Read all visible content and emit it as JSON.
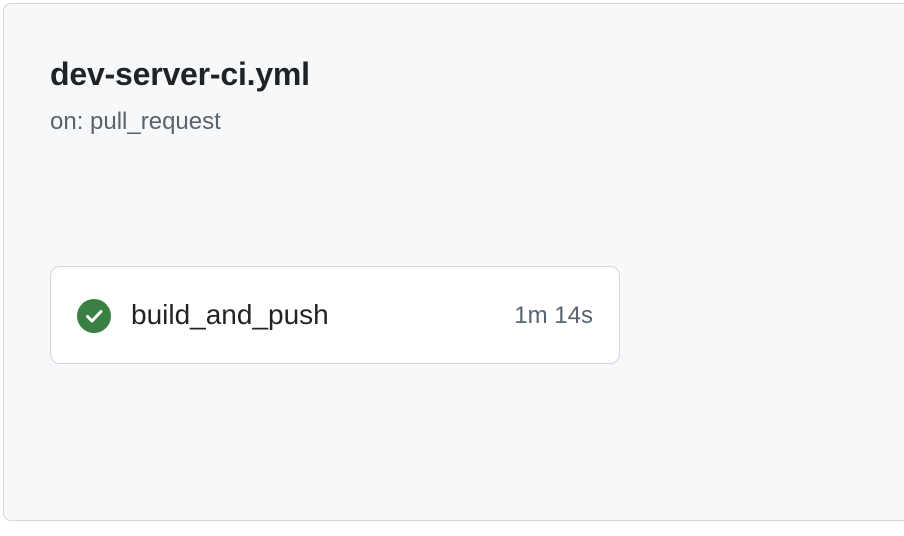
{
  "workflow": {
    "file_name": "dev-server-ci.yml",
    "trigger": "on: pull_request"
  },
  "job": {
    "name": "build_and_push",
    "duration": "1m 14s",
    "status": "success",
    "status_icon": "check-circle-fill-icon",
    "status_color": "#3a7f44"
  },
  "colors": {
    "panel_background": "#f6f8fa",
    "border": "#d0d7de",
    "text_primary": "#1f2328",
    "text_muted": "#59636e"
  }
}
